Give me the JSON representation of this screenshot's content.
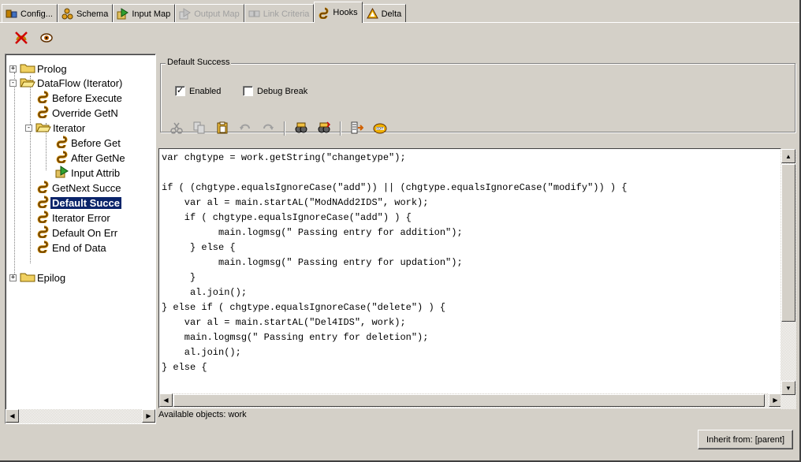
{
  "tabs": [
    {
      "label": "Config...",
      "icon": "config-icon",
      "state": "normal"
    },
    {
      "label": "Schema",
      "icon": "schema-icon",
      "state": "normal"
    },
    {
      "label": "Input Map",
      "icon": "input-map-icon",
      "state": "normal"
    },
    {
      "label": "Output Map",
      "icon": "output-map-icon",
      "state": "disabled"
    },
    {
      "label": "Link Criteria",
      "icon": "link-criteria-icon",
      "state": "disabled"
    },
    {
      "label": "Hooks",
      "icon": "hook-icon",
      "state": "active"
    },
    {
      "label": "Delta",
      "icon": "delta-icon",
      "state": "normal"
    }
  ],
  "toolbar": {
    "icons": [
      "delete-hooks-icon",
      "view-icon"
    ]
  },
  "tree": {
    "nodes": [
      {
        "label": "Prolog",
        "type": "folder",
        "expander": "+"
      },
      {
        "label": "DataFlow (Iterator)",
        "type": "folder-open",
        "expander": "-"
      },
      {
        "label": "Before Execute",
        "type": "hook"
      },
      {
        "label": "Override GetN",
        "type": "hook"
      },
      {
        "label": "Iterator",
        "type": "folder-open",
        "expander": "-"
      },
      {
        "label": "Before Get",
        "type": "hook"
      },
      {
        "label": "After GetNe",
        "type": "hook"
      },
      {
        "label": "Input Attrib",
        "type": "map"
      },
      {
        "label": "GetNext Succe",
        "type": "hook"
      },
      {
        "label": "Default Succe",
        "type": "hook",
        "selected": true
      },
      {
        "label": "Iterator Error",
        "type": "hook"
      },
      {
        "label": "Default On Err",
        "type": "hook"
      },
      {
        "label": "End of Data",
        "type": "hook"
      },
      {
        "label": "Epilog",
        "type": "folder",
        "expander": "+"
      }
    ]
  },
  "group": {
    "title": "Default Success",
    "enabled_label": "Enabled",
    "enabled_checked": true,
    "debug_label": "Debug Break",
    "debug_checked": false,
    "checkmark": "✓"
  },
  "editor_toolbar": {
    "icons": [
      "cut-icon",
      "copy-icon",
      "paste-icon",
      "undo-icon",
      "redo-icon",
      "find-icon",
      "find-next-icon",
      "goto-line-icon",
      "edit-icon"
    ]
  },
  "code_lines": [
    "var chgtype = work.getString(\"changetype\");",
    "",
    "if ( (chgtype.equalsIgnoreCase(\"add\")) || (chgtype.equalsIgnoreCase(\"modify\")) ) {",
    "    var al = main.startAL(\"ModNAdd2IDS\", work);",
    "    if ( chgtype.equalsIgnoreCase(\"add\") ) {",
    "          main.logmsg(\" Passing entry for addition\");",
    "     } else {",
    "          main.logmsg(\" Passing entry for updation\");",
    "     }",
    "     al.join();",
    "} else if ( chgtype.equalsIgnoreCase(\"delete\") ) {",
    "    var al = main.startAL(\"Del4IDS\", work);",
    "    main.logmsg(\" Passing entry for deletion\");",
    "    al.join();",
    "} else {"
  ],
  "available_objects": "Available objects: work",
  "inherit_button": "Inherit from: [parent]",
  "colors": {
    "selection": "#0a246a",
    "hook_icon": "#c08000",
    "folder": "#f0d060"
  }
}
